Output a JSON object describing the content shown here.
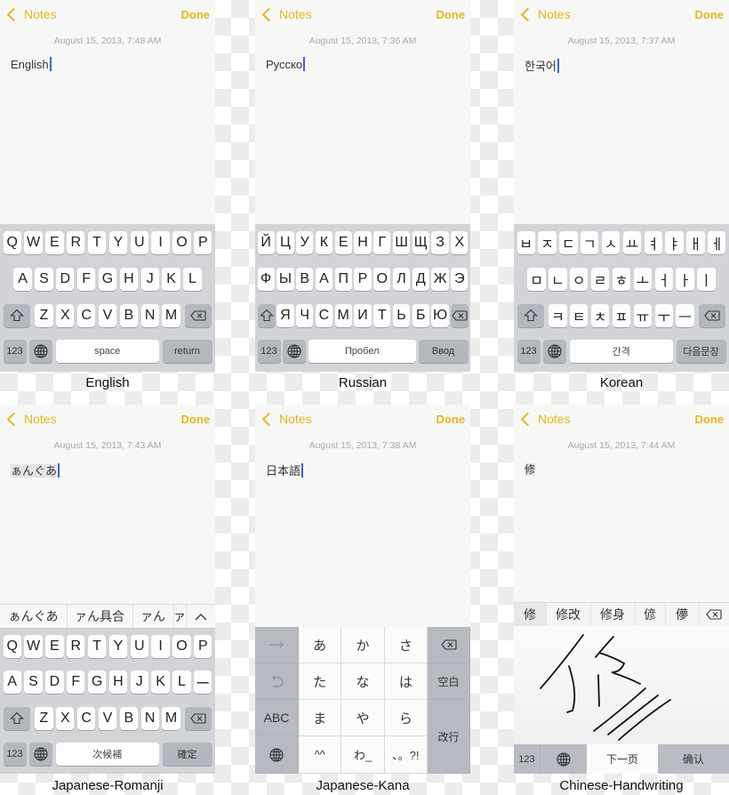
{
  "colors": {
    "accent": "#e2b721",
    "caret": "#3f61c9",
    "keyboard_bg": "#d2d4d8",
    "function_key": "#b3b7be"
  },
  "nav": {
    "back_label": "Notes",
    "done_label": "Done"
  },
  "icons": {
    "back": "chevron-left-icon",
    "shift": "shift-icon",
    "delete": "backspace-icon",
    "globe": "globe-icon",
    "arrow_right": "arrow-right-icon",
    "undo": "undo-icon",
    "chevron_up": "chevron-up-icon"
  },
  "panels": [
    {
      "caption": "English",
      "date": "August 15, 2013, 7:48 AM",
      "note_text": "English",
      "keyboard": {
        "row1": [
          "Q",
          "W",
          "E",
          "R",
          "T",
          "Y",
          "U",
          "I",
          "O",
          "P"
        ],
        "row2": [
          "A",
          "S",
          "D",
          "F",
          "G",
          "H",
          "J",
          "K",
          "L"
        ],
        "row3": [
          "Z",
          "X",
          "C",
          "V",
          "B",
          "N",
          "M"
        ],
        "numbers": "123",
        "space": "space",
        "return": "return"
      }
    },
    {
      "caption": "Russian",
      "date": "August 15, 2013, 7:36 AM",
      "note_text": "Русско",
      "keyboard": {
        "row1": [
          "Й",
          "Ц",
          "У",
          "К",
          "Е",
          "Н",
          "Г",
          "Ш",
          "Щ",
          "З",
          "Х"
        ],
        "row2": [
          "Ф",
          "Ы",
          "В",
          "А",
          "П",
          "Р",
          "О",
          "Л",
          "Д",
          "Ж",
          "Э"
        ],
        "row3": [
          "Я",
          "Ч",
          "С",
          "М",
          "И",
          "Т",
          "Ь",
          "Б",
          "Ю"
        ],
        "numbers": "123",
        "space": "Пробел",
        "return": "Ввод"
      }
    },
    {
      "caption": "Korean",
      "date": "August 15, 2013, 7:37 AM",
      "note_text": "한국어",
      "keyboard": {
        "row1": [
          "ㅂ",
          "ㅈ",
          "ㄷ",
          "ㄱ",
          "ㅅ",
          "ㅛ",
          "ㅕ",
          "ㅑ",
          "ㅐ",
          "ㅔ"
        ],
        "row2": [
          "ㅁ",
          "ㄴ",
          "ㅇ",
          "ㄹ",
          "ㅎ",
          "ㅗ",
          "ㅓ",
          "ㅏ",
          "ㅣ"
        ],
        "row3": [
          "ㅋ",
          "ㅌ",
          "ㅊ",
          "ㅍ",
          "ㅠ",
          "ㅜ",
          "ㅡ"
        ],
        "numbers": "123",
        "space": "간격",
        "return": "다음문장"
      }
    },
    {
      "caption": "Japanese-Romanji",
      "date": "August 15, 2013, 7:43 AM",
      "note_text": "ぁんぐあ",
      "candidates": [
        "ぁんぐあ",
        "ァん具合",
        "ァん",
        "ァ"
      ],
      "keyboard": {
        "row1": [
          "Q",
          "W",
          "E",
          "R",
          "T",
          "Y",
          "U",
          "I",
          "O",
          "P"
        ],
        "row2": [
          "A",
          "S",
          "D",
          "F",
          "G",
          "H",
          "J",
          "K",
          "L",
          "ー"
        ],
        "row3": [
          "Z",
          "X",
          "C",
          "V",
          "B",
          "N",
          "M"
        ],
        "numbers": "123",
        "space": "次候補",
        "return": "確定"
      }
    },
    {
      "caption": "Japanese-Kana",
      "date": "August 15, 2013, 7:38 AM",
      "note_text": "日本語",
      "keyboard": {
        "grid": [
          [
            "あ",
            "か",
            "さ"
          ],
          [
            "た",
            "な",
            "は"
          ],
          [
            "ま",
            "や",
            "ら"
          ],
          [
            "^^",
            "わ_",
            "、。?!"
          ]
        ],
        "abc": "ABC",
        "space": "空白",
        "return": "改行"
      }
    },
    {
      "caption": "Chinese-Handwriting",
      "date": "August 15, 2013, 7:44 AM",
      "note_text": "修",
      "candidates": [
        "修",
        "修改",
        "修身",
        "偐",
        "儚"
      ],
      "keyboard": {
        "numbers": "123",
        "next_page": "下一页",
        "confirm": "确认"
      }
    }
  ]
}
